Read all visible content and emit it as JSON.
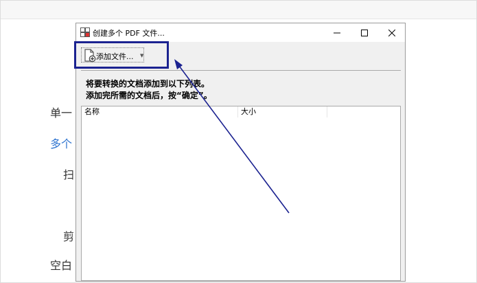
{
  "background": {
    "items": [
      {
        "label": "单一",
        "style": "normal"
      },
      {
        "label": "多个",
        "style": "link"
      },
      {
        "label": "扫",
        "style": "normal"
      },
      {
        "label": "剪",
        "style": "normal"
      },
      {
        "label": "空白",
        "style": "normal"
      }
    ],
    "link_color": "#2f74d0"
  },
  "dialog": {
    "title": "创建多个 PDF 文件...",
    "app_icon": "create-pdf-icon",
    "controls": {
      "minimize": "minimize-icon",
      "maximize": "maximize-icon",
      "close": "close-icon"
    }
  },
  "toolbar": {
    "add_files_label": "添加文件...",
    "add_files_icon": "add-document-icon",
    "dropdown_icon": "dropdown-arrow-icon"
  },
  "instructions": {
    "line1": "将要转换的文档添加到以下列表。",
    "line2": "添加完所需的文档后，按“确定”。"
  },
  "file_list": {
    "columns": [
      "名称",
      "大小"
    ],
    "rows": []
  },
  "annotation": {
    "color": "#1b2290"
  }
}
